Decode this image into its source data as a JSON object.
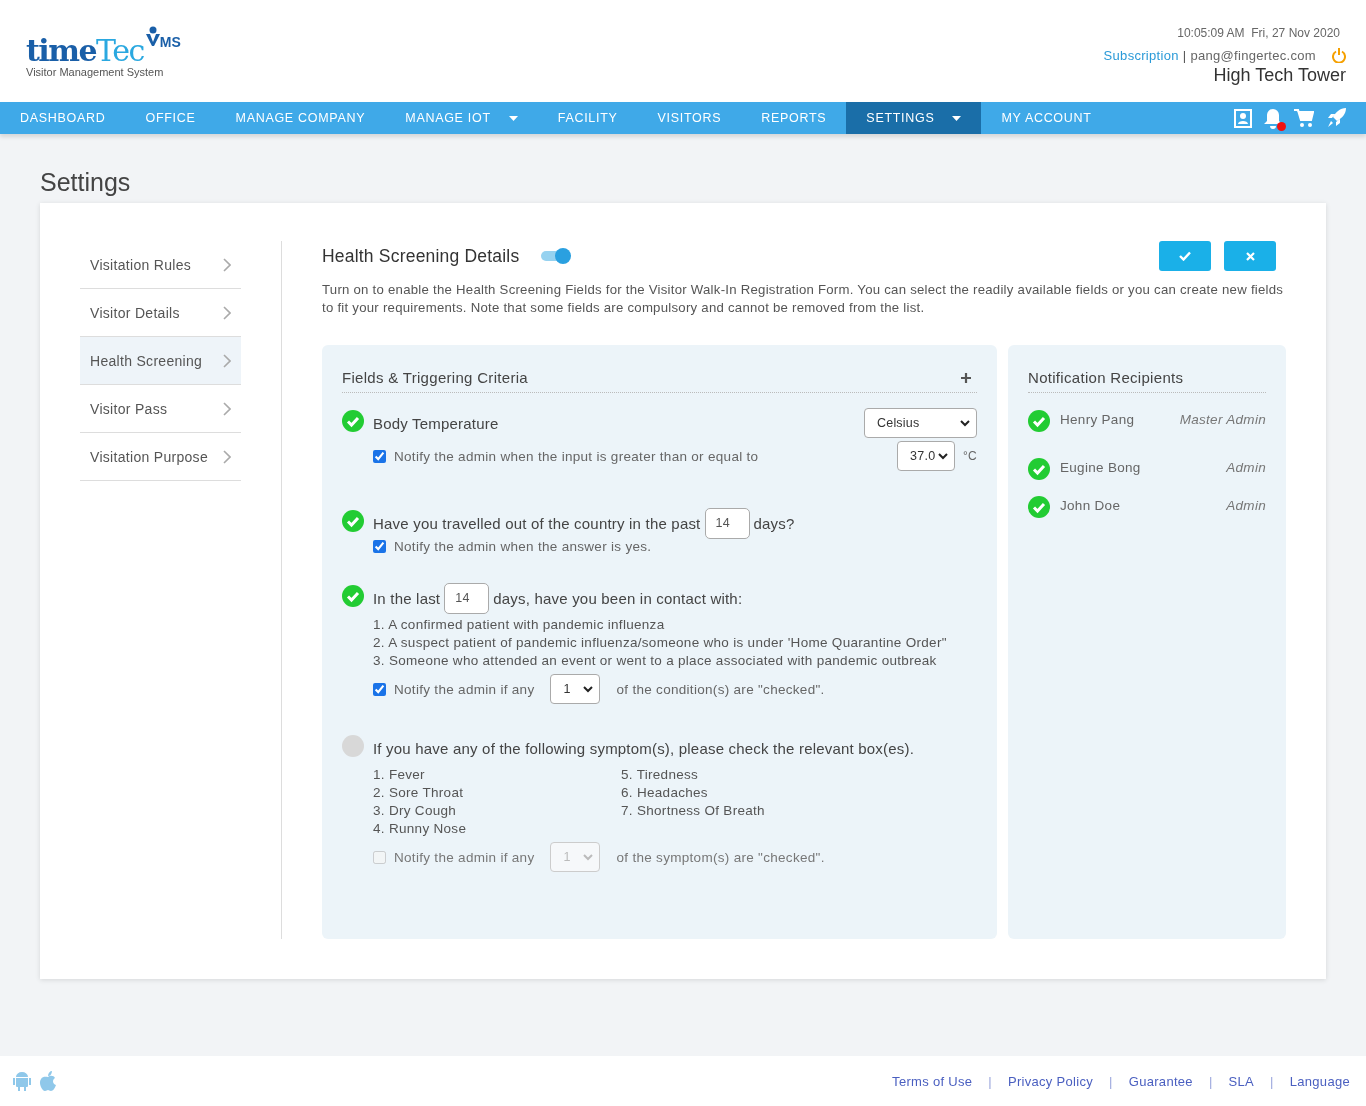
{
  "header": {
    "logo": {
      "name_dark": "time",
      "name_light": "Tec",
      "badge": "MS",
      "tagline": "Visitor Management System"
    },
    "datetime": "10:05:09 AM  Fri, 27 Nov 2020",
    "subscription": "Subscription",
    "separator": "|",
    "email": "pang@fingertec.com",
    "site": "High Tech Tower"
  },
  "nav": {
    "items": [
      {
        "label": "DASHBOARD",
        "selected": false,
        "dropdown": false
      },
      {
        "label": "OFFICE",
        "selected": false,
        "dropdown": false
      },
      {
        "label": "MANAGE COMPANY",
        "selected": false,
        "dropdown": false
      },
      {
        "label": "MANAGE IOT",
        "selected": false,
        "dropdown": true
      },
      {
        "label": "FACILITY",
        "selected": false,
        "dropdown": false
      },
      {
        "label": "VISITORS",
        "selected": false,
        "dropdown": false
      },
      {
        "label": "REPORTS",
        "selected": false,
        "dropdown": false
      },
      {
        "label": "SETTINGS",
        "selected": true,
        "dropdown": true
      },
      {
        "label": "MY ACCOUNT",
        "selected": false,
        "dropdown": false
      }
    ],
    "notification_dot": true
  },
  "page_title": "Settings",
  "sidebar": {
    "items": [
      {
        "label": "Visitation Rules",
        "selected": false
      },
      {
        "label": "Visitor Details",
        "selected": false
      },
      {
        "label": "Health Screening",
        "selected": true
      },
      {
        "label": "Visitor Pass",
        "selected": false
      },
      {
        "label": "Visitation Purpose",
        "selected": false
      }
    ]
  },
  "section": {
    "title": "Health Screening Details",
    "enabled": true,
    "description": "Turn on to enable the Health Screening Fields for the Visitor Walk-In Registration Form. You can select the readily available fields or you can create new fields to fit your requirements. Note that some fields are compulsory and cannot be removed from the list."
  },
  "criteria": {
    "title": "Fields & Triggering Criteria",
    "items": [
      {
        "kind": "temperature",
        "enabled": true,
        "label": "Body Temperature",
        "unit_select": "Celsius",
        "notify": {
          "checked": true,
          "text": "Notify the admin when the input is greater than or equal to",
          "value": "37.0",
          "unit": "°C"
        }
      },
      {
        "kind": "question",
        "enabled": true,
        "text_before": "Have you travelled out of the country in the past",
        "days": "14",
        "text_after": "days?",
        "notify": {
          "checked": true,
          "text": "Notify the admin when the answer is yes."
        }
      },
      {
        "kind": "list",
        "enabled": true,
        "text_before": "In the last",
        "days": "14",
        "text_after": "days, have you been in contact with:",
        "entries": [
          "1. A confirmed patient with pandemic influenza",
          "2. A suspect patient of pandemic influenza/someone who is under 'Home Quarantine Order\"",
          "3. Someone who attended an event or went to a place associated with pandemic outbreak"
        ],
        "notify": {
          "checked": true,
          "text_before": "Notify the admin if any",
          "value": "1",
          "text_after": "of the condition(s) are \"checked\"."
        }
      },
      {
        "kind": "columns",
        "enabled": false,
        "label": "If you have any of the following symptom(s), please check the relevant box(es).",
        "entries": [
          "1. Fever",
          "2. Sore Throat",
          "3. Dry Cough",
          "4. Runny Nose",
          "5. Tiredness",
          "6. Headaches",
          "7. Shortness Of Breath"
        ],
        "notify": {
          "checked": false,
          "text_before": "Notify the admin if any",
          "value": "1",
          "text_after": "of the symptom(s) are \"checked\"."
        }
      }
    ]
  },
  "recipients": {
    "title": "Notification Recipients",
    "items": [
      {
        "name": "Henry Pang",
        "role": "Master Admin",
        "enabled": true
      },
      {
        "name": "Eugine Bong",
        "role": "Admin",
        "enabled": true
      },
      {
        "name": "John Doe",
        "role": "Admin",
        "enabled": true
      }
    ]
  },
  "footer": {
    "links": [
      {
        "kind": "link",
        "text": "Terms of Use"
      },
      {
        "kind": "separator",
        "text": "|"
      },
      {
        "kind": "link",
        "text": "Privacy Policy"
      },
      {
        "kind": "separator",
        "text": "|"
      },
      {
        "kind": "link",
        "text": "Guarantee"
      },
      {
        "kind": "separator",
        "text": "|"
      },
      {
        "kind": "link",
        "text": "SLA"
      },
      {
        "kind": "separator",
        "text": "|"
      },
      {
        "kind": "link",
        "text": "Language"
      }
    ]
  }
}
